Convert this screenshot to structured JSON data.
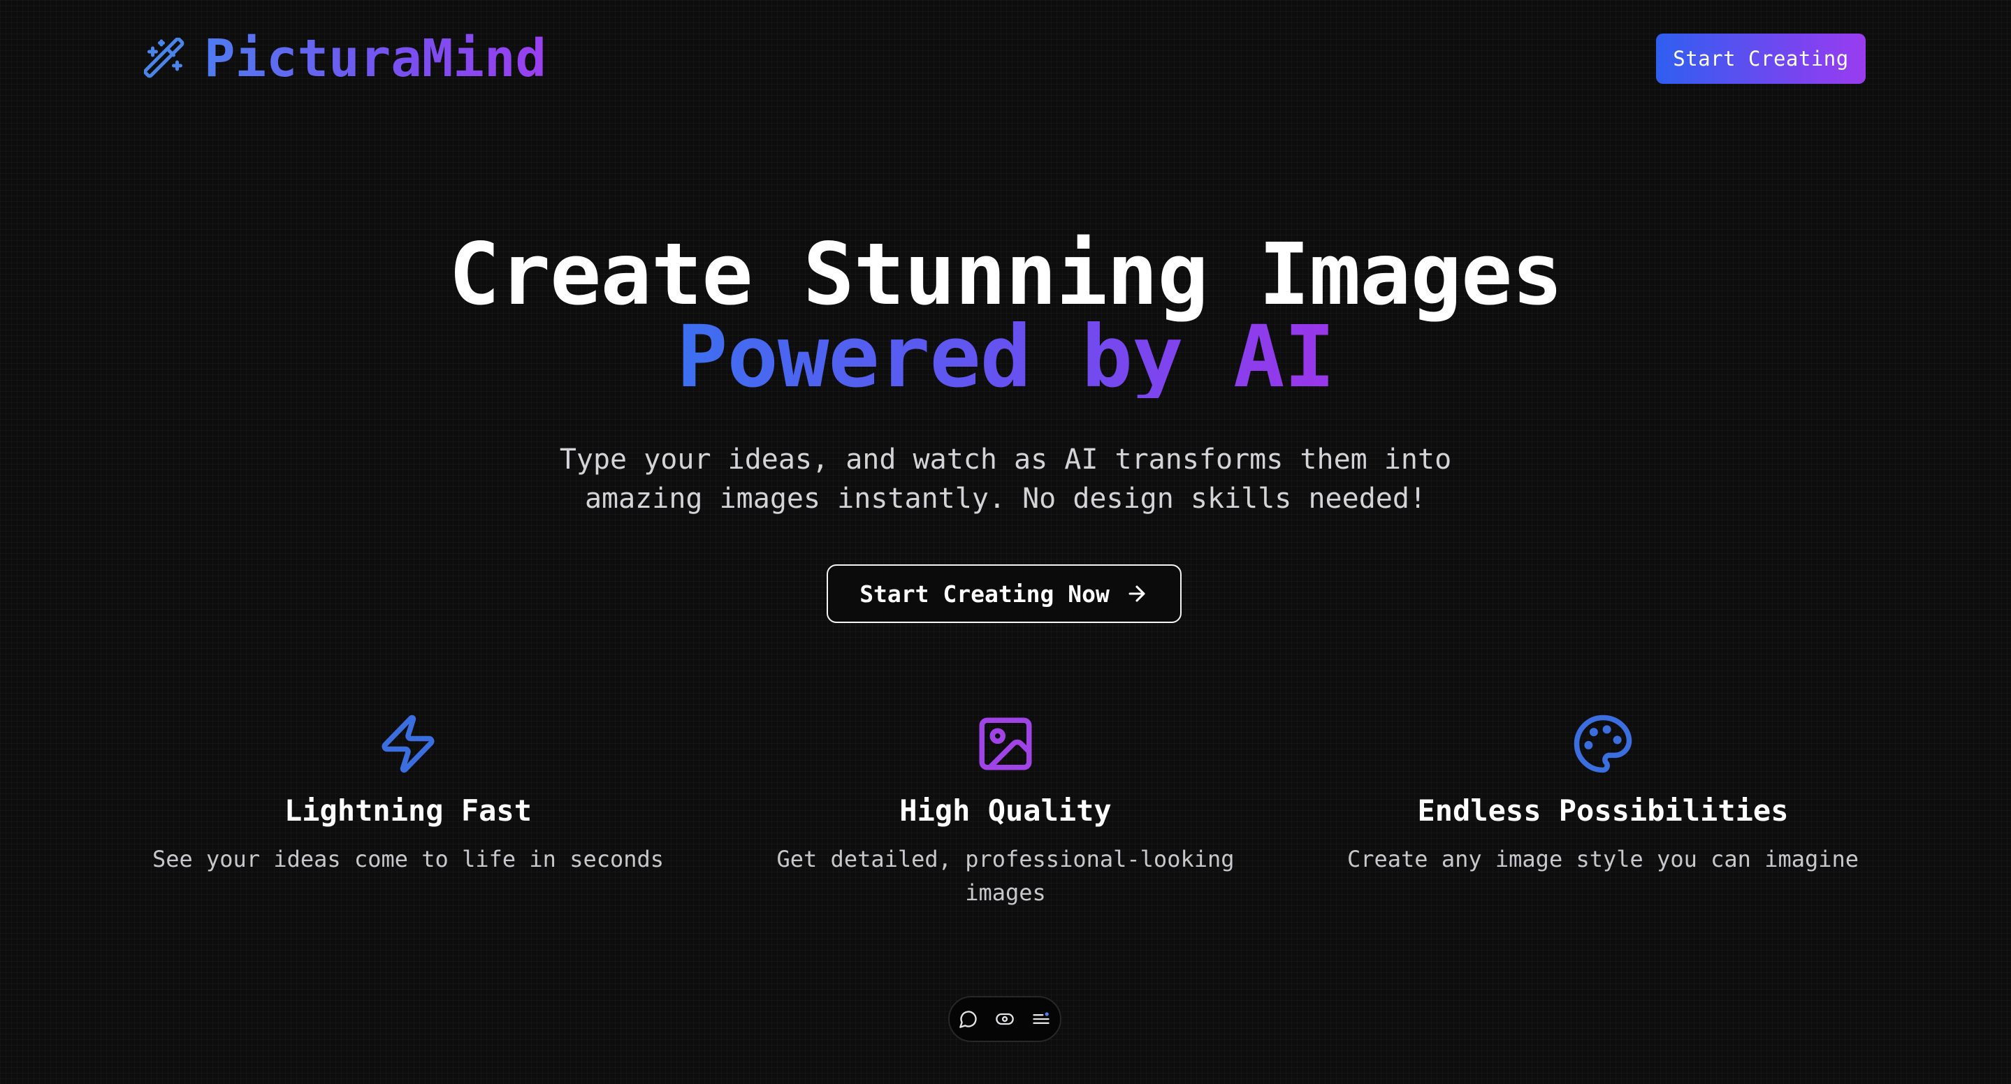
{
  "header": {
    "brand": "PicturaMind",
    "logo_icon": "magic-wand-icon",
    "cta_label": "Start Creating"
  },
  "hero": {
    "title_line1": "Create Stunning Images",
    "title_line2": "Powered by AI",
    "subtitle": "Type your ideas, and watch as AI transforms them into amazing images instantly. No design skills needed!",
    "cta_label": "Start Creating Now",
    "cta_icon": "arrow-right-icon"
  },
  "features": [
    {
      "icon": "lightning-icon",
      "title": "Lightning Fast",
      "description": "See your ideas come to life in seconds",
      "icon_color": "#3b6fe0"
    },
    {
      "icon": "image-icon",
      "title": "High Quality",
      "description": "Get detailed, professional-looking images",
      "icon_color": "#a044e8"
    },
    {
      "icon": "palette-icon",
      "title": "Endless Possibilities",
      "description": "Create any image style you can imagine",
      "icon_color": "#3b6fe0"
    }
  ],
  "dock": {
    "items": [
      "chat-bubble-icon",
      "toggle-eye-icon",
      "menu-list-icon"
    ]
  },
  "colors": {
    "background": "#0d0d0e",
    "accent_blue": "#3d70f0",
    "accent_purple": "#9a36ea",
    "text_muted": "#c8c8cc"
  }
}
